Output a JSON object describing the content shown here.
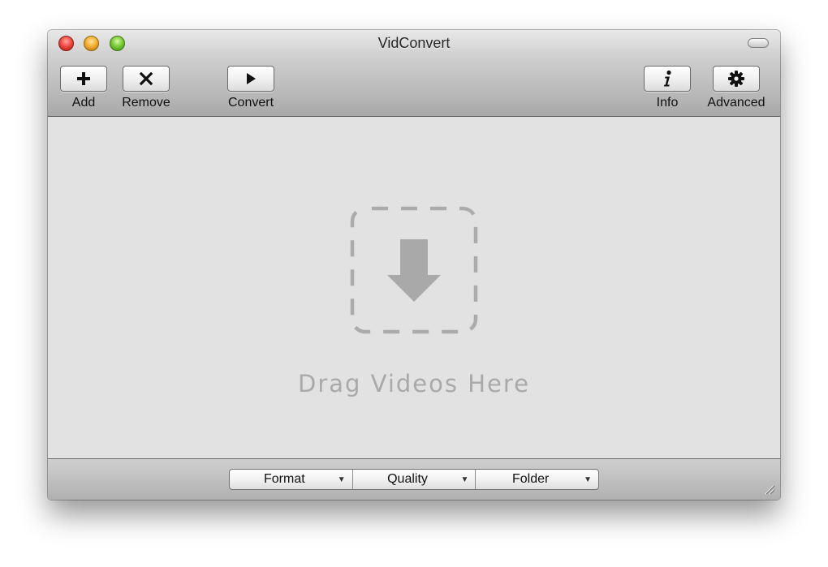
{
  "window": {
    "title": "VidConvert"
  },
  "toolbar": {
    "add_label": "Add",
    "remove_label": "Remove",
    "convert_label": "Convert",
    "info_label": "Info",
    "advanced_label": "Advanced",
    "add_icon": "plus-icon",
    "remove_icon": "x-icon",
    "convert_icon": "play-icon",
    "info_icon": "info-icon",
    "advanced_icon": "gear-icon"
  },
  "dropzone": {
    "text": "Drag Videos Here",
    "icon": "download-arrow-icon"
  },
  "bottombar": {
    "popups": [
      {
        "label": "Format",
        "arrow": "▼"
      },
      {
        "label": "Quality",
        "arrow": "▼"
      },
      {
        "label": "Folder",
        "arrow": "▼"
      }
    ]
  },
  "colors": {
    "content_bg": "#e2e2e2",
    "drop_icon": "#a9a9a9"
  }
}
